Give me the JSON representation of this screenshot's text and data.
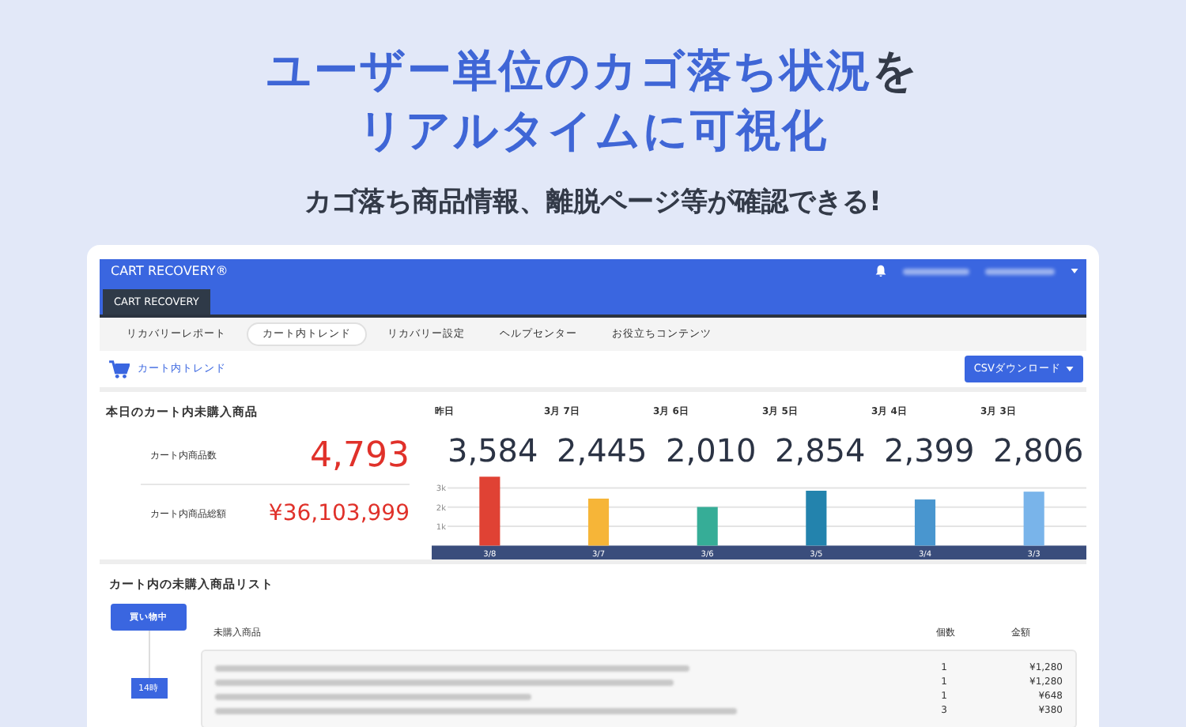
{
  "headline": {
    "lines": [
      [
        {
          "text": "ユーザー単位のカゴ落ち状況",
          "kind": "accent"
        },
        {
          "text": "を",
          "kind": "plain"
        }
      ],
      [
        {
          "text": "リアルタイムに可視化",
          "kind": "accent"
        }
      ]
    ],
    "subtitle": "カゴ落ち商品情報、離脱ページ等が確認できる!"
  },
  "app": {
    "logo": "CART RECOVERY®",
    "product_tab": "CART RECOVERY",
    "nav_tabs": [
      {
        "label": "リカバリーレポート",
        "selected": false
      },
      {
        "label": "カート内トレンド",
        "selected": true
      },
      {
        "label": "リカバリー設定",
        "selected": false
      },
      {
        "label": "ヘルプセンター",
        "selected": false
      },
      {
        "label": "お役立ちコンテンツ",
        "selected": false
      }
    ],
    "page_title": "カート内トレンド",
    "csv_button": "CSVダウンロード",
    "today": {
      "title": "本日のカート内未購入商品",
      "stats": [
        {
          "label": "カート内商品数",
          "value": "4,793"
        },
        {
          "label": "カート内商品総額",
          "value": "¥36,103,999"
        }
      ]
    },
    "days": [
      {
        "label": "昨日",
        "value": "3,584"
      },
      {
        "label": "3月 7日",
        "value": "2,445"
      },
      {
        "label": "3月 6日",
        "value": "2,010"
      },
      {
        "label": "3月 5日",
        "value": "2,854"
      },
      {
        "label": "3月 4日",
        "value": "2,399"
      },
      {
        "label": "3月 3日",
        "value": "2,806"
      }
    ],
    "chart_data": {
      "type": "bar",
      "categories": [
        "3/8",
        "3/7",
        "3/6",
        "3/5",
        "3/4",
        "3/3"
      ],
      "values": [
        3584,
        2445,
        2010,
        2854,
        2399,
        2806
      ],
      "colors": [
        "#e04234",
        "#f6b538",
        "#36ad97",
        "#2383ad",
        "#4996cf",
        "#79b4ea"
      ],
      "ylim": [
        0,
        3800
      ],
      "grid": true,
      "yticks": [
        {
          "value": 1000,
          "label": "1k"
        },
        {
          "value": 2000,
          "label": "2k"
        },
        {
          "value": 3000,
          "label": "3k"
        }
      ]
    },
    "list": {
      "title": "カート内の未購入商品リスト",
      "status_badge": "買い物中",
      "columns": [
        "未購入商品",
        "個数",
        "金額"
      ],
      "rows": [
        {
          "qty": "1",
          "price": "¥1,280"
        },
        {
          "qty": "1",
          "price": "¥1,280"
        },
        {
          "qty": "1",
          "price": "¥648"
        },
        {
          "qty": "3",
          "price": "¥380"
        }
      ],
      "time_badge": "14時"
    }
  }
}
